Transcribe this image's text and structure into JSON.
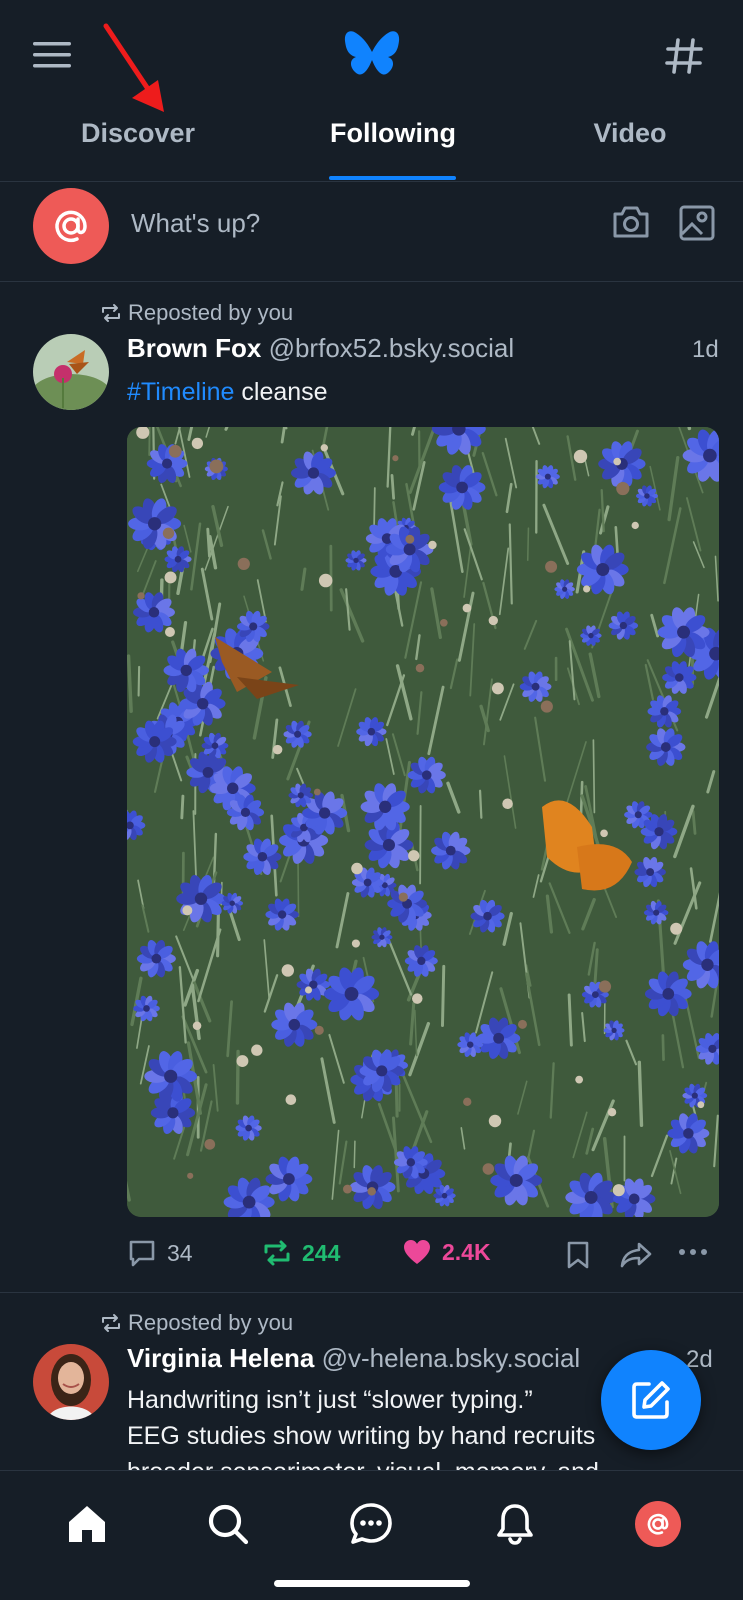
{
  "header": {
    "tabs": [
      {
        "label": "Discover",
        "active": false
      },
      {
        "label": "Following",
        "active": true
      },
      {
        "label": "Video",
        "active": false
      }
    ],
    "icons": {
      "menu": "menu-icon",
      "logo": "butterfly-logo",
      "feeds": "hash-icon"
    }
  },
  "composer": {
    "placeholder": "What's up?"
  },
  "posts": [
    {
      "repost_label": "Reposted by you",
      "name": "Brown Fox",
      "handle": "@brfox52.bsky.social",
      "time": "1d",
      "hashtag": "#Timeline",
      "text_rest": " cleanse",
      "replies": "34",
      "reposts": "244",
      "likes": "2.4K"
    },
    {
      "repost_label": "Reposted by you",
      "name": "Virginia Helena",
      "handle": "@v-helena.bsky.social",
      "time": "2d",
      "text_lines": [
        "Handwriting isn’t just “slower typing.”",
        "EEG studies show writing by hand recruits",
        "broader sensorimotor, visual, memory, and"
      ]
    }
  ],
  "colors": {
    "accent": "#1083fe",
    "repost_green": "#20bc71",
    "like_pink": "#ec4899",
    "background": "#161e27"
  }
}
